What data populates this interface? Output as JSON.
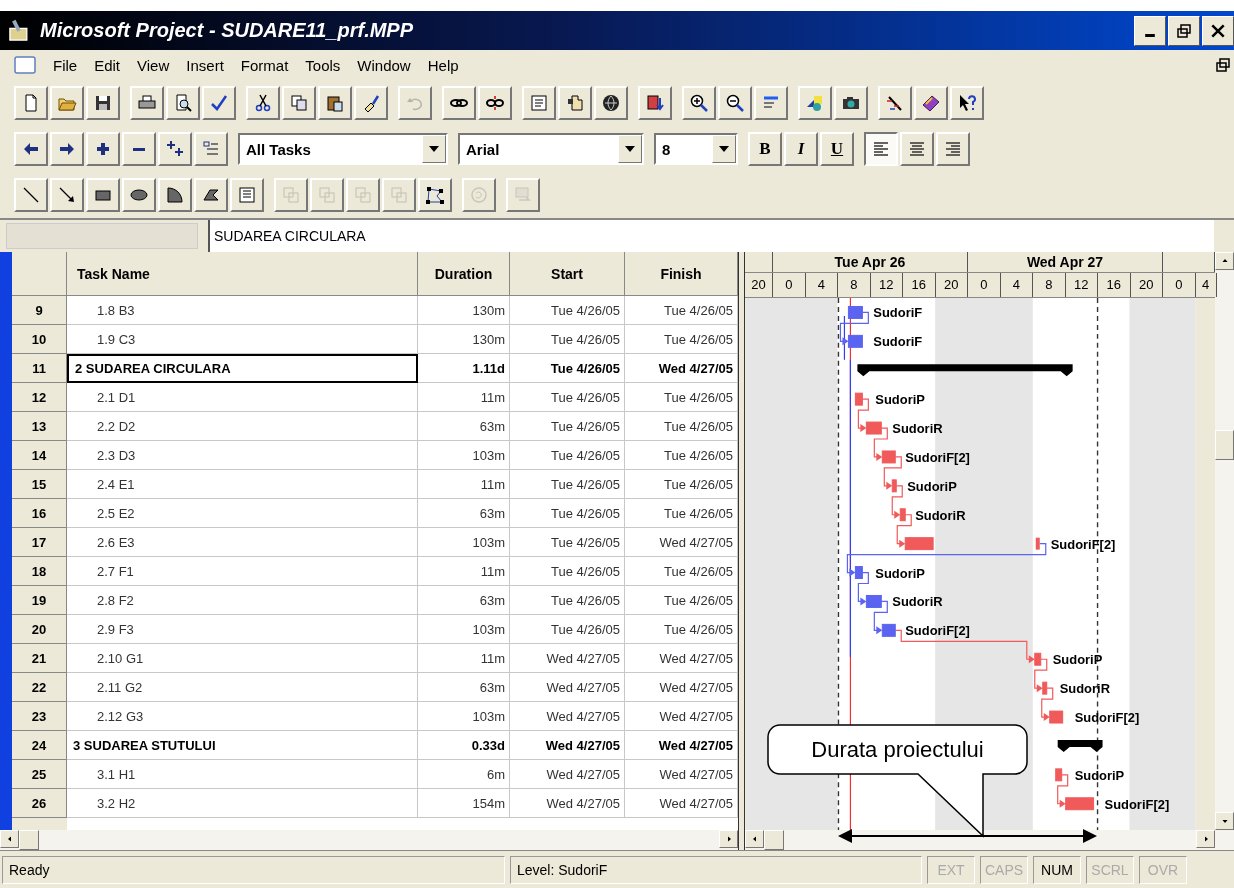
{
  "window": {
    "title": "Microsoft Project - SUDARE11_prf.MPP"
  },
  "menu": [
    {
      "label": "File"
    },
    {
      "label": "Edit"
    },
    {
      "label": "View"
    },
    {
      "label": "Insert"
    },
    {
      "label": "Format"
    },
    {
      "label": "Tools"
    },
    {
      "label": "Window"
    },
    {
      "label": "Help"
    }
  ],
  "toolbars": {
    "standard": [
      [
        {
          "disabled": false
        },
        {
          "disabled": false
        },
        {
          "disabled": false
        }
      ],
      [
        {
          "disabled": false
        },
        {
          "disabled": false
        },
        {
          "disabled": false
        }
      ],
      [
        {
          "disabled": false
        },
        {
          "disabled": false
        },
        {
          "disabled": false
        },
        {
          "disabled": false
        }
      ],
      [
        {
          "disabled": true
        }
      ],
      [
        {
          "disabled": false
        },
        {
          "disabled": false
        }
      ],
      [
        {
          "disabled": false
        },
        {
          "disabled": false
        },
        {
          "disabled": false
        }
      ],
      [
        {
          "disabled": false
        }
      ],
      [
        {
          "disabled": false
        },
        {
          "disabled": false
        },
        {
          "disabled": false
        }
      ],
      [
        {
          "disabled": false
        },
        {
          "disabled": false
        }
      ],
      [
        {
          "disabled": false
        },
        {
          "disabled": false
        },
        {
          "disabled": false
        }
      ]
    ],
    "navigation": [
      {
        "disabled": false
      },
      {
        "disabled": false
      },
      {
        "disabled": false
      },
      {
        "disabled": false
      },
      {
        "disabled": false
      },
      {
        "disabled": false
      }
    ],
    "filter": {
      "value": "All Tasks"
    },
    "font": {
      "value": "Arial"
    },
    "size": {
      "value": "8"
    },
    "styles": [
      {
        "label": "B",
        "selected": false
      },
      {
        "label": "I",
        "selected": false
      },
      {
        "label": "U",
        "selected": false
      }
    ],
    "alignment": [
      {
        "selected": true
      },
      {
        "selected": false
      },
      {
        "selected": false
      }
    ],
    "drawing": [
      [
        {
          "disabled": false
        },
        {
          "disabled": false
        },
        {
          "disabled": false
        },
        {
          "disabled": false
        },
        {
          "disabled": false
        },
        {
          "disabled": false
        },
        {
          "disabled": false
        }
      ],
      [
        {
          "disabled": true
        },
        {
          "disabled": true
        },
        {
          "disabled": true
        },
        {
          "disabled": true
        },
        {
          "disabled": false
        }
      ],
      [
        {
          "disabled": true
        }
      ],
      [
        {
          "disabled": true
        }
      ]
    ]
  },
  "entry_bar": {
    "value": "SUDAREA CIRCULARA"
  },
  "table": {
    "columns": [
      "Task Name",
      "Duration",
      "Start",
      "Finish"
    ],
    "rows": [
      {
        "id": "9",
        "name": "1.8 B3",
        "duration": "130m",
        "start": "Tue 4/26/05",
        "finish": "Tue 4/26/05",
        "summary": false,
        "selected": false
      },
      {
        "id": "10",
        "name": "1.9 C3",
        "duration": "130m",
        "start": "Tue 4/26/05",
        "finish": "Tue 4/26/05",
        "summary": false,
        "selected": false
      },
      {
        "id": "11",
        "name": "2 SUDAREA CIRCULARA",
        "duration": "1.11d",
        "start": "Tue 4/26/05",
        "finish": "Wed 4/27/05",
        "summary": true,
        "selected": true
      },
      {
        "id": "12",
        "name": "2.1 D1",
        "duration": "11m",
        "start": "Tue 4/26/05",
        "finish": "Tue 4/26/05",
        "summary": false,
        "selected": false
      },
      {
        "id": "13",
        "name": "2.2 D2",
        "duration": "63m",
        "start": "Tue 4/26/05",
        "finish": "Tue 4/26/05",
        "summary": false,
        "selected": false
      },
      {
        "id": "14",
        "name": "2.3 D3",
        "duration": "103m",
        "start": "Tue 4/26/05",
        "finish": "Tue 4/26/05",
        "summary": false,
        "selected": false
      },
      {
        "id": "15",
        "name": "2.4 E1",
        "duration": "11m",
        "start": "Tue 4/26/05",
        "finish": "Tue 4/26/05",
        "summary": false,
        "selected": false
      },
      {
        "id": "16",
        "name": "2.5 E2",
        "duration": "63m",
        "start": "Tue 4/26/05",
        "finish": "Tue 4/26/05",
        "summary": false,
        "selected": false
      },
      {
        "id": "17",
        "name": "2.6 E3",
        "duration": "103m",
        "start": "Tue 4/26/05",
        "finish": "Wed 4/27/05",
        "summary": false,
        "selected": false
      },
      {
        "id": "18",
        "name": "2.7 F1",
        "duration": "11m",
        "start": "Tue 4/26/05",
        "finish": "Tue 4/26/05",
        "summary": false,
        "selected": false
      },
      {
        "id": "19",
        "name": "2.8 F2",
        "duration": "63m",
        "start": "Tue 4/26/05",
        "finish": "Tue 4/26/05",
        "summary": false,
        "selected": false
      },
      {
        "id": "20",
        "name": "2.9 F3",
        "duration": "103m",
        "start": "Tue 4/26/05",
        "finish": "Tue 4/26/05",
        "summary": false,
        "selected": false
      },
      {
        "id": "21",
        "name": "2.10 G1",
        "duration": "11m",
        "start": "Wed 4/27/05",
        "finish": "Wed 4/27/05",
        "summary": false,
        "selected": false
      },
      {
        "id": "22",
        "name": "2.11 G2",
        "duration": "63m",
        "start": "Wed 4/27/05",
        "finish": "Wed 4/27/05",
        "summary": false,
        "selected": false
      },
      {
        "id": "23",
        "name": "2.12 G3",
        "duration": "103m",
        "start": "Wed 4/27/05",
        "finish": "Wed 4/27/05",
        "summary": false,
        "selected": false
      },
      {
        "id": "24",
        "name": "3 SUDAREA STUTULUI",
        "duration": "0.33d",
        "start": "Wed 4/27/05",
        "finish": "Wed 4/27/05",
        "summary": true,
        "selected": false
      },
      {
        "id": "25",
        "name": "3.1 H1",
        "duration": "6m",
        "start": "Wed 4/27/05",
        "finish": "Wed 4/27/05",
        "summary": false,
        "selected": false
      },
      {
        "id": "26",
        "name": "3.2 H2",
        "duration": "154m",
        "start": "Wed 4/27/05",
        "finish": "Wed 4/27/05",
        "summary": false,
        "selected": false
      }
    ]
  },
  "gantt": {
    "days": [
      "Tue Apr 26",
      "Wed Apr 27"
    ],
    "hours": [
      "20",
      "0",
      "4",
      "8",
      "12",
      "16",
      "20",
      "0",
      "4",
      "8",
      "12",
      "16",
      "20",
      "0",
      "4"
    ],
    "bars": [
      {
        "kind": "task",
        "label": "SudoriF",
        "color": "#5a64f0"
      },
      {
        "kind": "task",
        "label": "SudoriF",
        "color": "#5a64f0"
      },
      {
        "kind": "summary"
      },
      {
        "kind": "task",
        "label": "SudoriP",
        "color": "#f05a5a"
      },
      {
        "kind": "task",
        "label": "SudoriR",
        "color": "#f05a5a"
      },
      {
        "kind": "task",
        "label": "SudoriF[2]",
        "color": "#f05a5a"
      },
      {
        "kind": "task",
        "label": "SudoriP",
        "color": "#f05a5a"
      },
      {
        "kind": "task",
        "label": "SudoriR",
        "color": "#f05a5a"
      },
      {
        "kind": "task",
        "label": "SudoriF[2]",
        "color": "#f05a5a"
      },
      {
        "kind": "task",
        "label": "SudoriP",
        "color": "#5a64f0"
      },
      {
        "kind": "task",
        "label": "SudoriR",
        "color": "#5a64f0"
      },
      {
        "kind": "task",
        "label": "SudoriF[2]",
        "color": "#5a64f0"
      },
      {
        "kind": "task",
        "label": "SudoriP",
        "color": "#f05a5a"
      },
      {
        "kind": "task",
        "label": "SudoriR",
        "color": "#f05a5a"
      },
      {
        "kind": "task",
        "label": "SudoriF[2]",
        "color": "#f05a5a"
      },
      {
        "kind": "summary"
      },
      {
        "kind": "task",
        "label": "SudoriP",
        "color": "#f05a5a"
      },
      {
        "kind": "task",
        "label": "SudoriF[2]",
        "color": "#f05a5a"
      }
    ]
  },
  "callout": {
    "text": "Durata proiectului"
  },
  "status_bar": {
    "message": "Ready",
    "level": "Level: SudoriF",
    "indicators": [
      {
        "label": "EXT",
        "on": false
      },
      {
        "label": "CAPS",
        "on": false
      },
      {
        "label": "NUM",
        "on": true
      },
      {
        "label": "SCRL",
        "on": false
      },
      {
        "label": "OVR",
        "on": false
      }
    ]
  }
}
